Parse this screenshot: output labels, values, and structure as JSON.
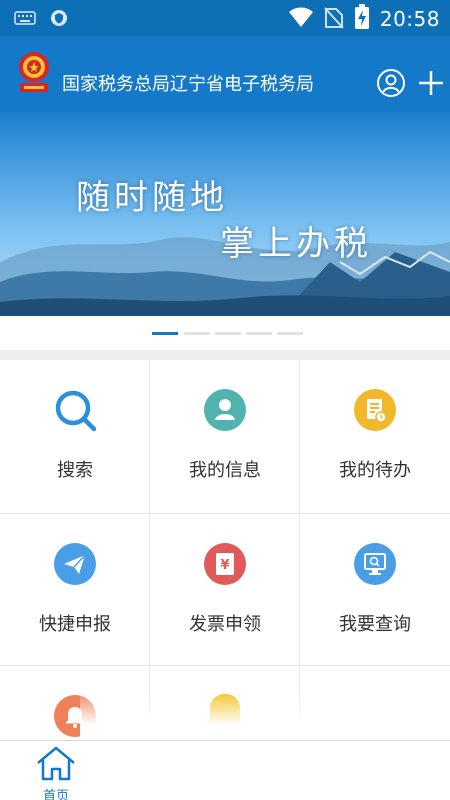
{
  "status_bar": {
    "time": "20:58",
    "icons": [
      "keyboard-icon",
      "vpn-shield-icon",
      "wifi-icon",
      "no-sim-icon",
      "battery-charging-icon"
    ]
  },
  "header": {
    "title": "国家税务总局辽宁省电子税务局",
    "icons": [
      "tax-emblem-icon",
      "user-icon",
      "plus-icon"
    ]
  },
  "banner": {
    "slogan_line1": "随时随地",
    "slogan_line2": "掌上办税",
    "page_count": 5,
    "active_page": 1
  },
  "services": [
    {
      "label": "搜索",
      "icon": "search-icon",
      "color": "#2b8fdc"
    },
    {
      "label": "我的信息",
      "icon": "profile-icon",
      "color": "#52b3ae"
    },
    {
      "label": "我的待办",
      "icon": "todo-document-icon",
      "color": "#f0b82a"
    },
    {
      "label": "快捷申报",
      "icon": "paper-plane-icon",
      "color": "#4a9ee6"
    },
    {
      "label": "发票申领",
      "icon": "invoice-yuan-icon",
      "color": "#e05a5a"
    },
    {
      "label": "我要查询",
      "icon": "query-monitor-icon",
      "color": "#4a9ee6"
    },
    {
      "label": "",
      "icon": "bell-icon",
      "color": "#f0805a"
    },
    {
      "label": "",
      "icon": "yellow-tile-icon",
      "color": "#f3c21e"
    }
  ],
  "bottom_nav": {
    "home_label": "首页",
    "icon": "home-icon"
  },
  "colors": {
    "primary": "#1479c9",
    "status_bar": "#0d6fb6"
  }
}
